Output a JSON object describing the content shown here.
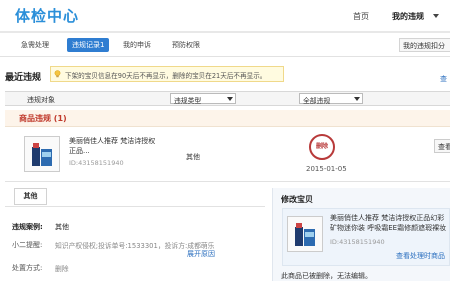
{
  "header": {
    "title": "体检中心",
    "home_link": "首页",
    "my_violations": "我的违规"
  },
  "nav": {
    "tabs": [
      "急需处理",
      "违规记录1",
      "我的申诉",
      "预防权限"
    ],
    "active_index": 1,
    "right_button": "我的违规扣分"
  },
  "section": {
    "title": "最近违规",
    "notice": "下架的宝贝信息在90天后不再显示，删除的宝贝在21天后不再显示。",
    "right_link": "查"
  },
  "table": {
    "col_object": "违规对象",
    "filter_type": "违规类型",
    "filter_status": "全部违规"
  },
  "goods": {
    "group_title": "商品违规 (1)",
    "item_title": "美丽俏佳人推荐 梵洁诗授权正品...",
    "item_id": "ID:43158151940",
    "type": "其他",
    "stamp": "删除",
    "date": "2015-01-05",
    "action_button": "查看"
  },
  "detail": {
    "tab_label": "其他",
    "case_label": "违规案例:",
    "case_value": "其他",
    "hint_label": "小二提醒:",
    "hint_value": "知识产权侵权;投诉单号:1533301，投诉方:成都萌乐",
    "expand_link": "展开原因",
    "handling_label": "处置方式:",
    "handling_value": "删除"
  },
  "right_panel": {
    "title": "修改宝贝",
    "item_text": "美丽俏佳人推荐 梵洁诗授权正品幻彩矿物迷你装 呼吸霜EE霜修颜遮瑕裸妆",
    "item_id": "ID:43158151940",
    "link": "查看处理时商品",
    "note": "此商品已被删除，无法编辑。"
  },
  "colors": {
    "brand_blue": "#2b8fd9",
    "active_tab": "#2f7dd1",
    "violation_red": "#c0392b",
    "stamp_red": "#b83a3a",
    "link_blue": "#2b6fbf",
    "notice_bg": "#fffbe0"
  }
}
